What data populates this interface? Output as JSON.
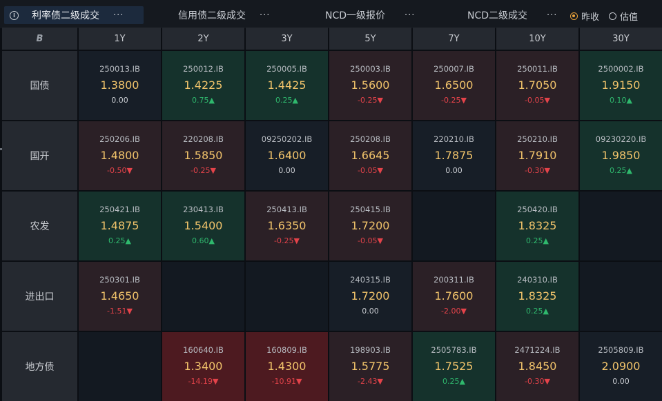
{
  "tabs": [
    {
      "label": "利率债二级成交",
      "more": "···",
      "active": true
    },
    {
      "label": "信用债二级成交",
      "more": "···",
      "active": false
    },
    {
      "label": "NCD一级报价",
      "more": "···",
      "active": false
    },
    {
      "label": "NCD二级成交",
      "more": "···",
      "active": false
    }
  ],
  "radio_options": [
    {
      "label": "昨收",
      "selected": true
    },
    {
      "label": "估值",
      "selected": false
    }
  ],
  "corner_logo": "B",
  "columns": [
    "1Y",
    "2Y",
    "3Y",
    "5Y",
    "7Y",
    "10Y",
    "30Y"
  ],
  "rows": [
    {
      "label": "国债",
      "cells": [
        {
          "code": "250013.IB",
          "yield": "1.3800",
          "change": "0.00",
          "dir": "flat",
          "bg": "neutral"
        },
        {
          "code": "250012.IB",
          "yield": "1.4225",
          "change": "0.75▲",
          "dir": "up",
          "bg": "green"
        },
        {
          "code": "250005.IB",
          "yield": "1.4425",
          "change": "0.25▲",
          "dir": "up",
          "bg": "green"
        },
        {
          "code": "250003.IB",
          "yield": "1.5600",
          "change": "-0.25▼",
          "dir": "down",
          "bg": "red"
        },
        {
          "code": "250007.IB",
          "yield": "1.6500",
          "change": "-0.25▼",
          "dir": "down",
          "bg": "red"
        },
        {
          "code": "250011.IB",
          "yield": "1.7050",
          "change": "-0.05▼",
          "dir": "down",
          "bg": "red"
        },
        {
          "code": "2500002.IB",
          "yield": "1.9150",
          "change": "0.10▲",
          "dir": "up",
          "bg": "green"
        }
      ]
    },
    {
      "label": "国开",
      "cells": [
        {
          "code": "250206.IB",
          "yield": "1.4800",
          "change": "-0.50▼",
          "dir": "down",
          "bg": "red"
        },
        {
          "code": "220208.IB",
          "yield": "1.5850",
          "change": "-0.25▼",
          "dir": "down",
          "bg": "red"
        },
        {
          "code": "09250202.IB",
          "yield": "1.6400",
          "change": "0.00",
          "dir": "flat",
          "bg": "neutral"
        },
        {
          "code": "250208.IB",
          "yield": "1.6645",
          "change": "-0.05▼",
          "dir": "down",
          "bg": "red"
        },
        {
          "code": "220210.IB",
          "yield": "1.7875",
          "change": "0.00",
          "dir": "flat",
          "bg": "neutral"
        },
        {
          "code": "250210.IB",
          "yield": "1.7910",
          "change": "-0.30▼",
          "dir": "down",
          "bg": "red"
        },
        {
          "code": "09230220.IB",
          "yield": "1.9850",
          "change": "0.25▲",
          "dir": "up",
          "bg": "green"
        }
      ]
    },
    {
      "label": "农发",
      "cells": [
        {
          "code": "250421.IB",
          "yield": "1.4875",
          "change": "0.25▲",
          "dir": "up",
          "bg": "green"
        },
        {
          "code": "230413.IB",
          "yield": "1.5400",
          "change": "0.60▲",
          "dir": "up",
          "bg": "green"
        },
        {
          "code": "250413.IB",
          "yield": "1.6350",
          "change": "-0.25▼",
          "dir": "down",
          "bg": "red"
        },
        {
          "code": "250415.IB",
          "yield": "1.7200",
          "change": "-0.05▼",
          "dir": "down",
          "bg": "red"
        },
        null,
        {
          "code": "250420.IB",
          "yield": "1.8325",
          "change": "0.25▲",
          "dir": "up",
          "bg": "green"
        },
        null
      ]
    },
    {
      "label": "进出口",
      "cells": [
        {
          "code": "250301.IB",
          "yield": "1.4650",
          "change": "-1.51▼",
          "dir": "down",
          "bg": "red"
        },
        null,
        null,
        {
          "code": "240315.IB",
          "yield": "1.7200",
          "change": "0.00",
          "dir": "flat",
          "bg": "neutral"
        },
        {
          "code": "200311.IB",
          "yield": "1.7600",
          "change": "-2.00▼",
          "dir": "down",
          "bg": "red"
        },
        {
          "code": "240310.IB",
          "yield": "1.8325",
          "change": "0.25▲",
          "dir": "up",
          "bg": "green"
        },
        null
      ]
    },
    {
      "label": "地方债",
      "cells": [
        null,
        {
          "code": "160640.IB",
          "yield": "1.3400",
          "change": "-14.19▼",
          "dir": "down",
          "bg": "deepred"
        },
        {
          "code": "160809.IB",
          "yield": "1.4300",
          "change": "-10.91▼",
          "dir": "down",
          "bg": "deepred"
        },
        {
          "code": "198903.IB",
          "yield": "1.5775",
          "change": "-2.43▼",
          "dir": "down",
          "bg": "red"
        },
        {
          "code": "2505783.IB",
          "yield": "1.7525",
          "change": "0.25▲",
          "dir": "up",
          "bg": "green"
        },
        {
          "code": "2471224.IB",
          "yield": "1.8450",
          "change": "-0.30▼",
          "dir": "down",
          "bg": "red"
        },
        {
          "code": "2505809.IB",
          "yield": "2.0900",
          "change": "0.00",
          "dir": "flat",
          "bg": "neutral"
        }
      ]
    }
  ],
  "colors": {
    "yield": "#f2c46b",
    "up": "#2fb86d",
    "down": "#e4434a",
    "active_tab": "#1c2a3d",
    "radio_selected": "#e8a13a"
  }
}
